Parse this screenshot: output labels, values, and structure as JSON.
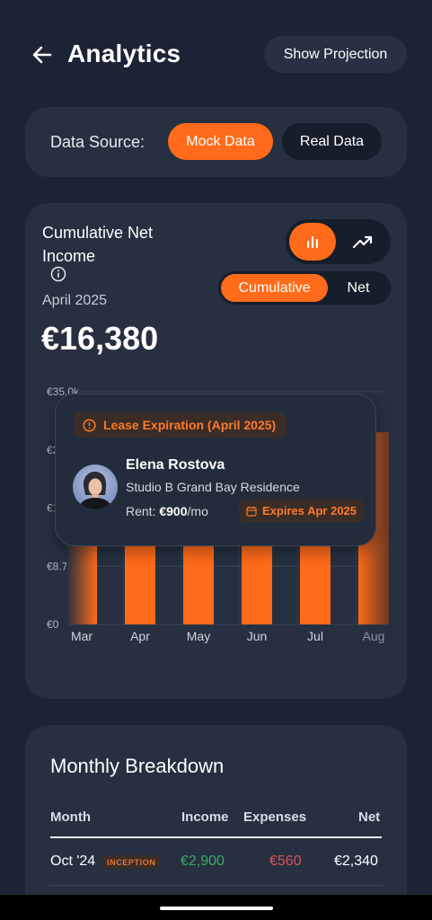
{
  "header": {
    "title": "Analytics",
    "projection_button": "Show Projection"
  },
  "data_source": {
    "label": "Data Source:",
    "options": [
      "Mock Data",
      "Real Data"
    ],
    "selected": "Mock Data"
  },
  "chart_card": {
    "title": "Cumulative Net Income",
    "period": "April 2025",
    "value": "€16,380",
    "chart_types": [
      "bar-chart-icon",
      "trending-up-icon"
    ],
    "selected_chart_type": "bar",
    "modes": [
      "Cumulative",
      "Net"
    ],
    "selected_mode": "Cumulative"
  },
  "chart_data": {
    "type": "bar",
    "categories": [
      "Mar",
      "Apr",
      "May",
      "Jun",
      "Jul",
      "Aug"
    ],
    "values": [
      28900,
      16380,
      23000,
      25500,
      27200,
      28900
    ],
    "y_ticks": [
      "€0",
      "€8.7k",
      "€17.5k",
      "€26.2k",
      "€35.0k"
    ],
    "ylim": [
      0,
      35000
    ],
    "grid": true,
    "accent": "#ff6b1a"
  },
  "tooltip": {
    "badge": "Lease Expiration (April 2025)",
    "tenant_name": "Elena Rostova",
    "property": "Studio B Grand Bay Residence",
    "rent_label": "Rent:",
    "rent_value": "€900",
    "rent_unit": "/mo",
    "expires": "Expires Apr 2025"
  },
  "breakdown": {
    "title": "Monthly Breakdown",
    "columns": [
      "Month",
      "Income",
      "Expenses",
      "Net"
    ],
    "rows": [
      {
        "month": "Oct '24",
        "tag": "INCEPTION",
        "income": "€2,900",
        "expenses": "€560",
        "net": "€2,340"
      }
    ],
    "colors": {
      "income": "#3fa866",
      "expenses": "#e0505a",
      "net": "#ffffff"
    }
  }
}
